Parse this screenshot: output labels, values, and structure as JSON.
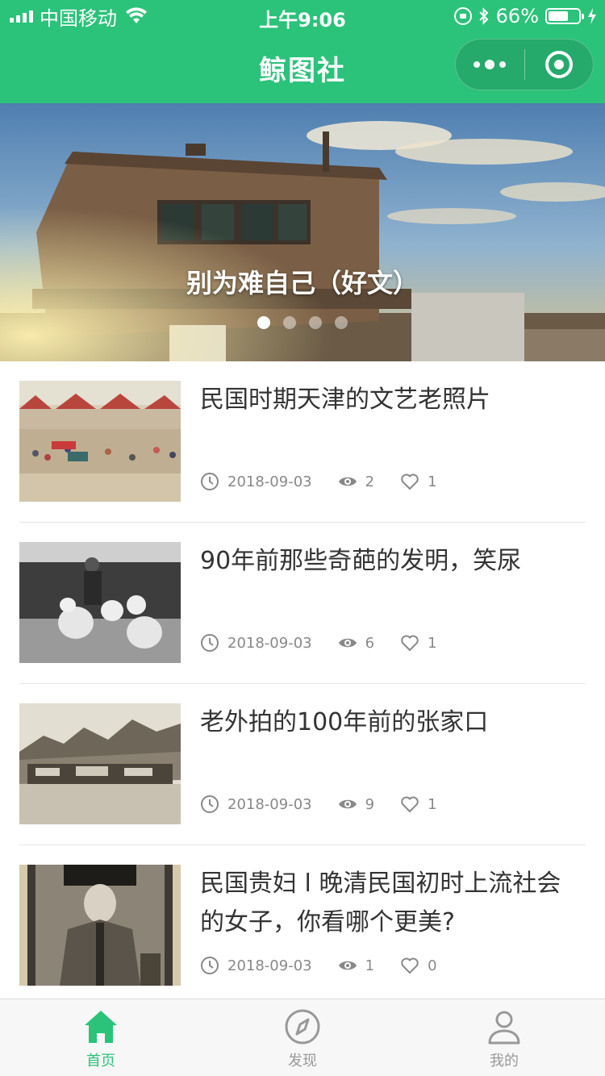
{
  "status_bar": {
    "carrier": "中国移动",
    "time": "上午9:06",
    "battery": "66%",
    "battery_level": 0.66
  },
  "nav": {
    "title": "鲸图社"
  },
  "banner": {
    "caption": "别为难自己（好文）",
    "dots_count": 4,
    "active_index": 0
  },
  "articles": [
    {
      "title": "民国时期天津的文艺老照片",
      "date": "2018-09-03",
      "views": "2",
      "likes": "1"
    },
    {
      "title": "90年前那些奇葩的发明，笑尿",
      "date": "2018-09-03",
      "views": "6",
      "likes": "1"
    },
    {
      "title": "老外拍的100年前的张家口",
      "date": "2018-09-03",
      "views": "9",
      "likes": "1"
    },
    {
      "title": "民国贵妇 l 晚清民国初时上流社会的女子，你看哪个更美?",
      "date": "2018-09-03",
      "views": "1",
      "likes": "0"
    }
  ],
  "tabs": [
    {
      "label": "首页",
      "icon": "home-icon",
      "active": true
    },
    {
      "label": "发现",
      "icon": "compass-icon",
      "active": false
    },
    {
      "label": "我的",
      "icon": "user-icon",
      "active": false
    }
  ],
  "colors": {
    "brand": "#2bc27a",
    "text_primary": "#333333",
    "text_meta": "#888888"
  }
}
